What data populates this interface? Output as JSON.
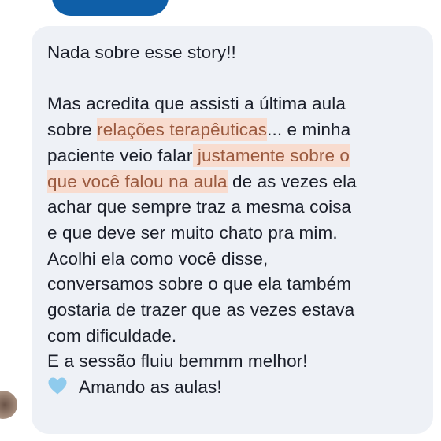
{
  "message": {
    "line1": "Nada sobre esse story!!",
    "l3a": "Mas acredita que assisti a última aula",
    "l4a": "sobre ",
    "l4hl": "relações terapêuticas",
    "l4b": "... e minha",
    "l5a": "paciente veio falar",
    "l5hl": " justamente sobre o",
    "l6hl": "que você falou na aula",
    "l6b": " de as vezes ela",
    "l7": "achar que sempre traz a mesma coisa",
    "l8": "e que deve ser muito chato pra mim.",
    "l9": "Acolhi ela como você disse,",
    "l10": "conversamos sobre o que ela também",
    "l11": "gostaria de trazer que as vezes estava",
    "l12": "com dificuldade.",
    "l13": "E a sessão fluiu bemmm melhor!",
    "l14": "Amando as aulas!"
  },
  "colors": {
    "previous_bubble": "#0f5fa8",
    "bubble_background": "#eef1f6",
    "highlight": "#f8dccf",
    "heart": "#8fcbed"
  },
  "icons": {
    "heart": "light-blue-heart-emoji"
  }
}
